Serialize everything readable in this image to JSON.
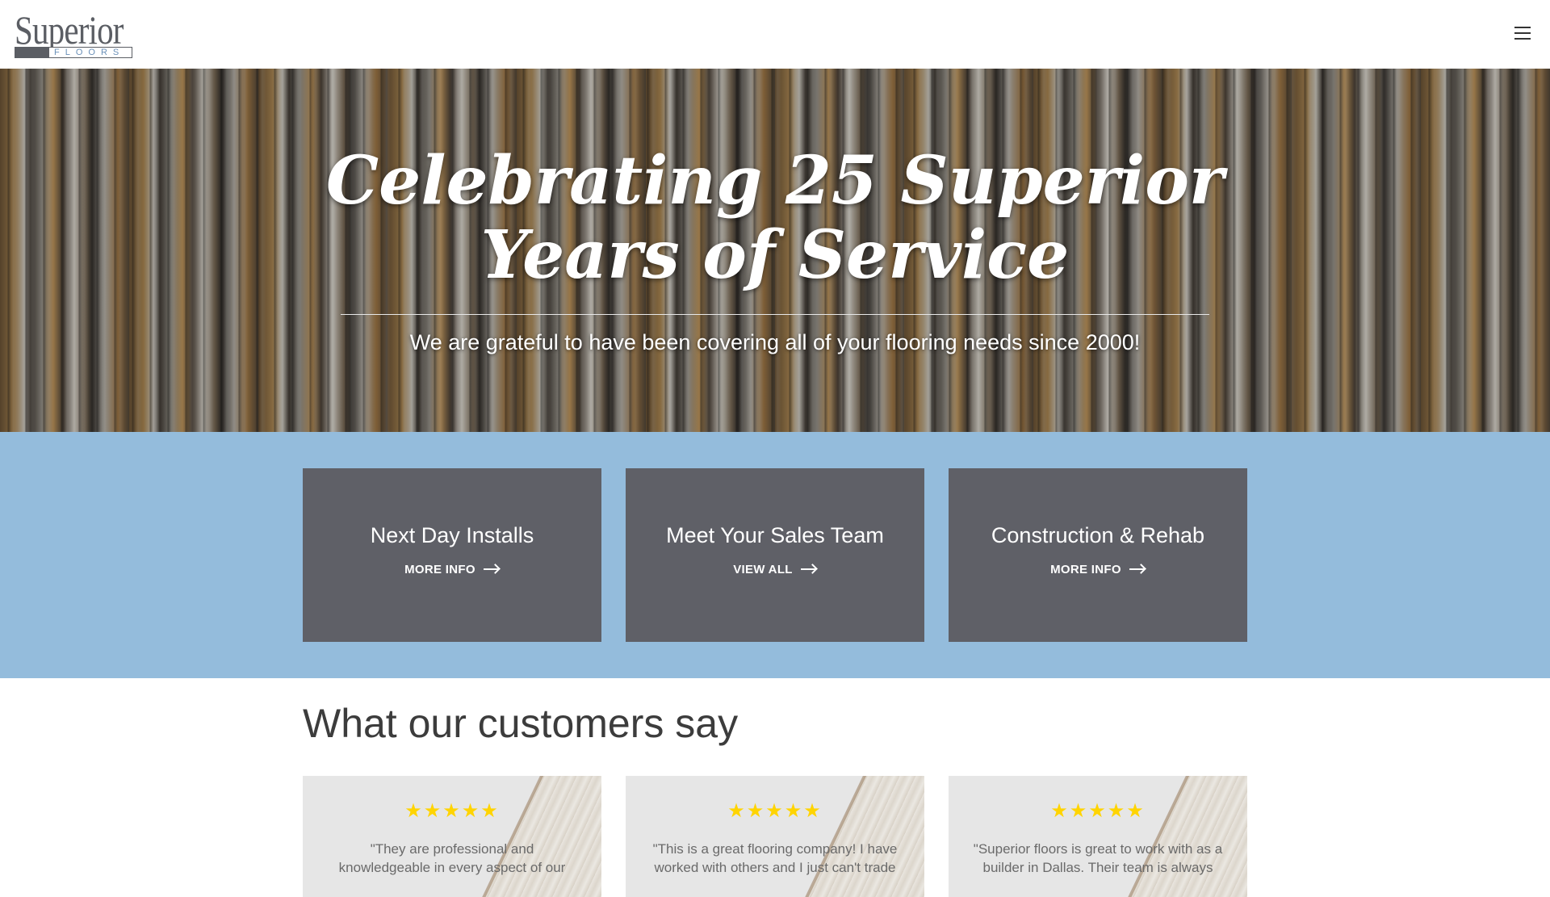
{
  "header": {
    "logo_word": "Superior",
    "logo_sub": "FLOORS",
    "menu_icon": "hamburger-icon"
  },
  "hero": {
    "title_line1": "Celebrating 25 Superior",
    "title_line2": "Years of Service",
    "subtitle": "We are grateful to have been covering all of your flooring needs since 2000!"
  },
  "cards": [
    {
      "title": "Next Day Installs",
      "cta": "MORE INFO"
    },
    {
      "title": "Meet Your Sales Team",
      "cta": "VIEW ALL"
    },
    {
      "title": "Construction & Rehab",
      "cta": "MORE INFO"
    }
  ],
  "testimonials": {
    "heading": "What our customers say",
    "items": [
      {
        "stars": "★★★★★",
        "rating": 5,
        "quote": "\"They are professional and knowledgeable in every aspect of our"
      },
      {
        "stars": "★★★★★",
        "rating": 5,
        "quote": "\"This is a great flooring company! I have worked with others and I just can't trade"
      },
      {
        "stars": "★★★★★",
        "rating": 5,
        "quote": "\"Superior floors is great to work with as a builder in Dallas. Their team is always"
      }
    ]
  },
  "colors": {
    "band": "#94bcdc",
    "card": "#5f6067",
    "star": "#ffd400",
    "logo": "#5b5e64"
  }
}
